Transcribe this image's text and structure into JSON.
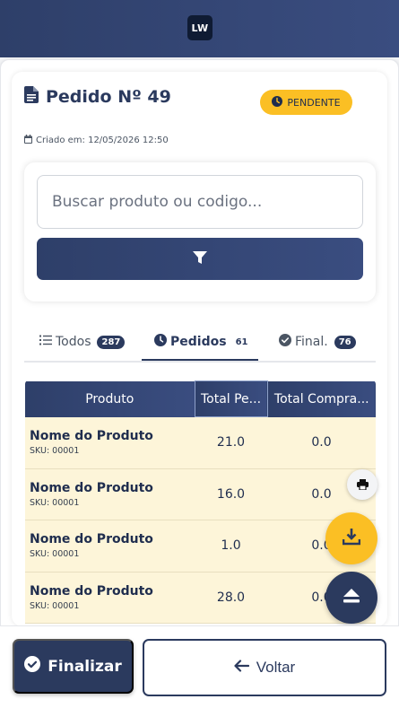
{
  "header": {
    "logo_text": "LW"
  },
  "order": {
    "title": "Pedido Nº 49",
    "status": "PENDENTE",
    "created_at": "Criado em: 12/05/2026 12:50"
  },
  "search": {
    "placeholder": "Buscar produto ou codigo..."
  },
  "tabs": [
    {
      "label": "Todos",
      "count": "287",
      "icon": "list-icon"
    },
    {
      "label": "Pedidos",
      "count": "61",
      "icon": "clock-icon"
    },
    {
      "label": "Final.",
      "count": "76",
      "icon": "check-circle-icon"
    }
  ],
  "table": {
    "headers": [
      "Produto",
      "Total Pe...",
      "Total Compra..."
    ],
    "rows": [
      {
        "name": "Nome do Produto",
        "sku": "SKU: 00001",
        "total_pedido": "21.0",
        "total_compra": "0.0"
      },
      {
        "name": "Nome do Produto",
        "sku": "SKU: 00001",
        "total_pedido": "16.0",
        "total_compra": "0.0"
      },
      {
        "name": "Nome do Produto",
        "sku": "SKU: 00001",
        "total_pedido": "1.0",
        "total_compra": "0.0"
      },
      {
        "name": "Nome do Produto",
        "sku": "SKU: 00001",
        "total_pedido": "28.0",
        "total_compra": "0.0"
      }
    ]
  },
  "actions": {
    "finalize_label": "Finalizar",
    "back_label": "Voltar"
  },
  "colors": {
    "primary": "#2b3a5e",
    "accent": "#fbbf24",
    "row_highlight": "#fdf5d9"
  }
}
